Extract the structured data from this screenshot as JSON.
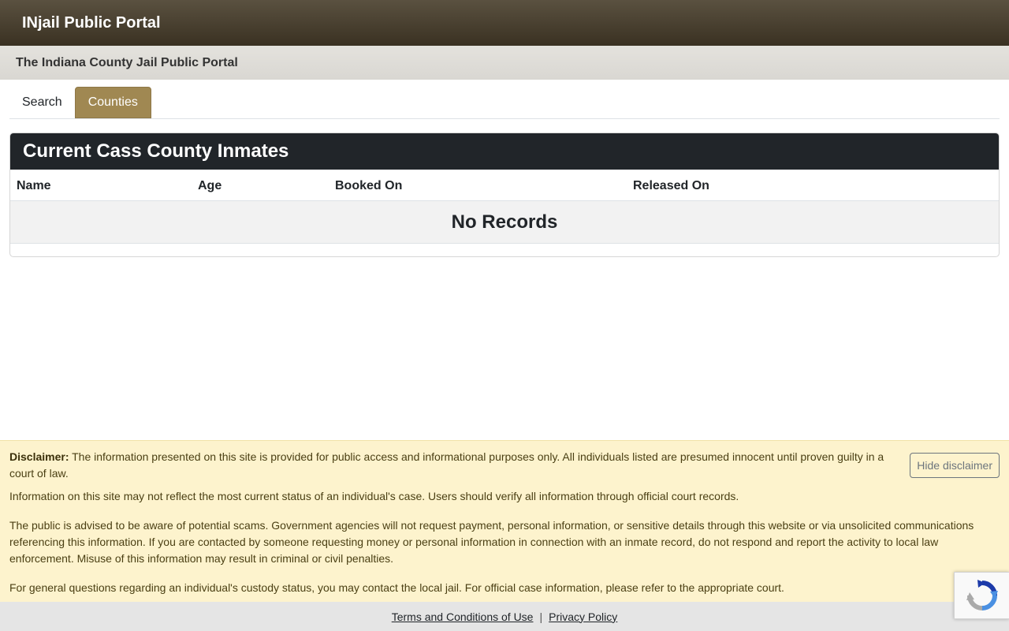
{
  "header": {
    "brand": "INjail Public Portal",
    "subtitle": "The Indiana County Jail Public Portal"
  },
  "tabs": [
    {
      "label": "Search",
      "active": false
    },
    {
      "label": "Counties",
      "active": true
    }
  ],
  "inmates": {
    "title": "Current Cass County Inmates",
    "columns": [
      "Name",
      "Age",
      "Booked On",
      "Released On"
    ],
    "empty_message": "No Records"
  },
  "disclaimer": {
    "label": "Disclaimer:",
    "p1": " The information presented on this site is provided for public access and informational purposes only. All individuals listed are presumed innocent until proven guilty in a court of law.",
    "p2": "Information on this site may not reflect the most current status of an individual's case. Users should verify all information through official court records.",
    "p3": "The public is advised to be aware of potential scams. Government agencies will not request payment, personal information, or sensitive details through this website or via unsolicited communications referencing this information. If you are contacted by someone requesting money or personal information in connection with an inmate record, do not respond and report the activity to local law enforcement. Misuse of this information may result in criminal or civil penalties.",
    "p4": "For general questions regarding an individual's custody status, you may contact the local jail. For official case information, please refer to the appropriate court.",
    "hide_label": "Hide disclaimer"
  },
  "footer": {
    "terms": "Terms and Conditions of Use",
    "separator": "|",
    "privacy": "Privacy Policy"
  },
  "colors": {
    "topbar": "#4a4130",
    "tab_active": "#a08852",
    "card_header": "#212529",
    "disclaimer_bg": "#fdf3cd"
  },
  "icons": {
    "recaptcha": "recaptcha-icon"
  }
}
